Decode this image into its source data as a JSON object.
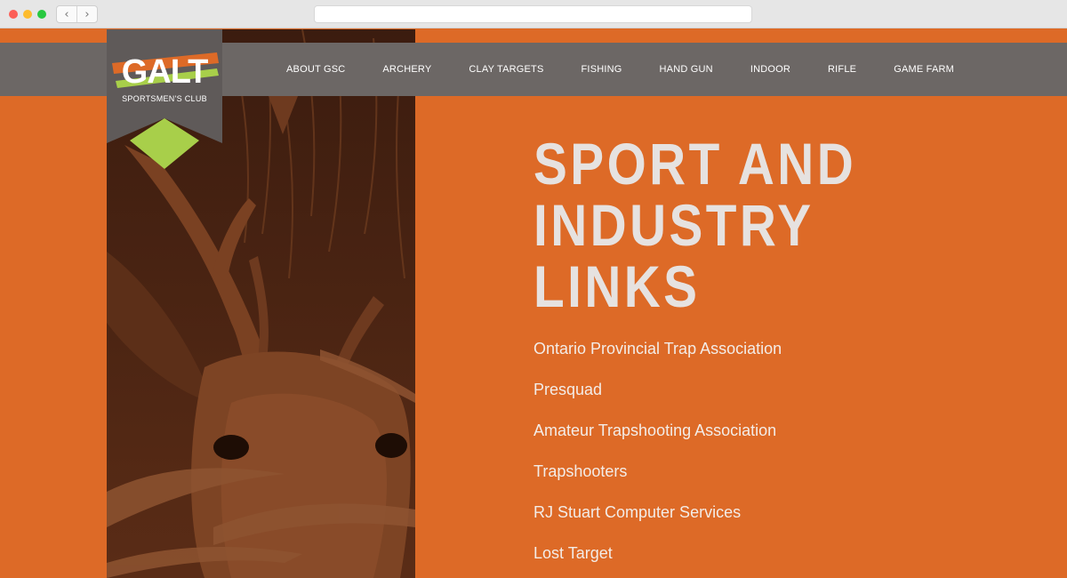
{
  "browser": {
    "back_glyph": "‹",
    "forward_glyph": "›",
    "url": ""
  },
  "brand": {
    "logo_word": "GALT",
    "logo_sub": "SPORTSMEN'S CLUB",
    "colors": {
      "orange": "#dd6a27",
      "header_gray": "#6c6765",
      "logo_gray": "#5f5a59",
      "lime": "#a8cf4a",
      "deer_tint": "#4a2413"
    }
  },
  "nav": {
    "items": [
      {
        "label": "ABOUT GSC"
      },
      {
        "label": "ARCHERY"
      },
      {
        "label": "CLAY TARGETS"
      },
      {
        "label": "FISHING"
      },
      {
        "label": "HAND GUN"
      },
      {
        "label": "INDOOR"
      },
      {
        "label": "RIFLE"
      },
      {
        "label": "GAME FARM"
      }
    ]
  },
  "main": {
    "title_line1": "SPORT AND",
    "title_line2": "INDUSTRY",
    "title_line3": "LINKS",
    "links": [
      {
        "label": "Ontario Provincial Trap Association"
      },
      {
        "label": "Presquad"
      },
      {
        "label": "Amateur Trapshooting Association"
      },
      {
        "label": "Trapshooters"
      },
      {
        "label": "RJ Stuart Computer Services"
      },
      {
        "label": "Lost Target"
      }
    ]
  }
}
